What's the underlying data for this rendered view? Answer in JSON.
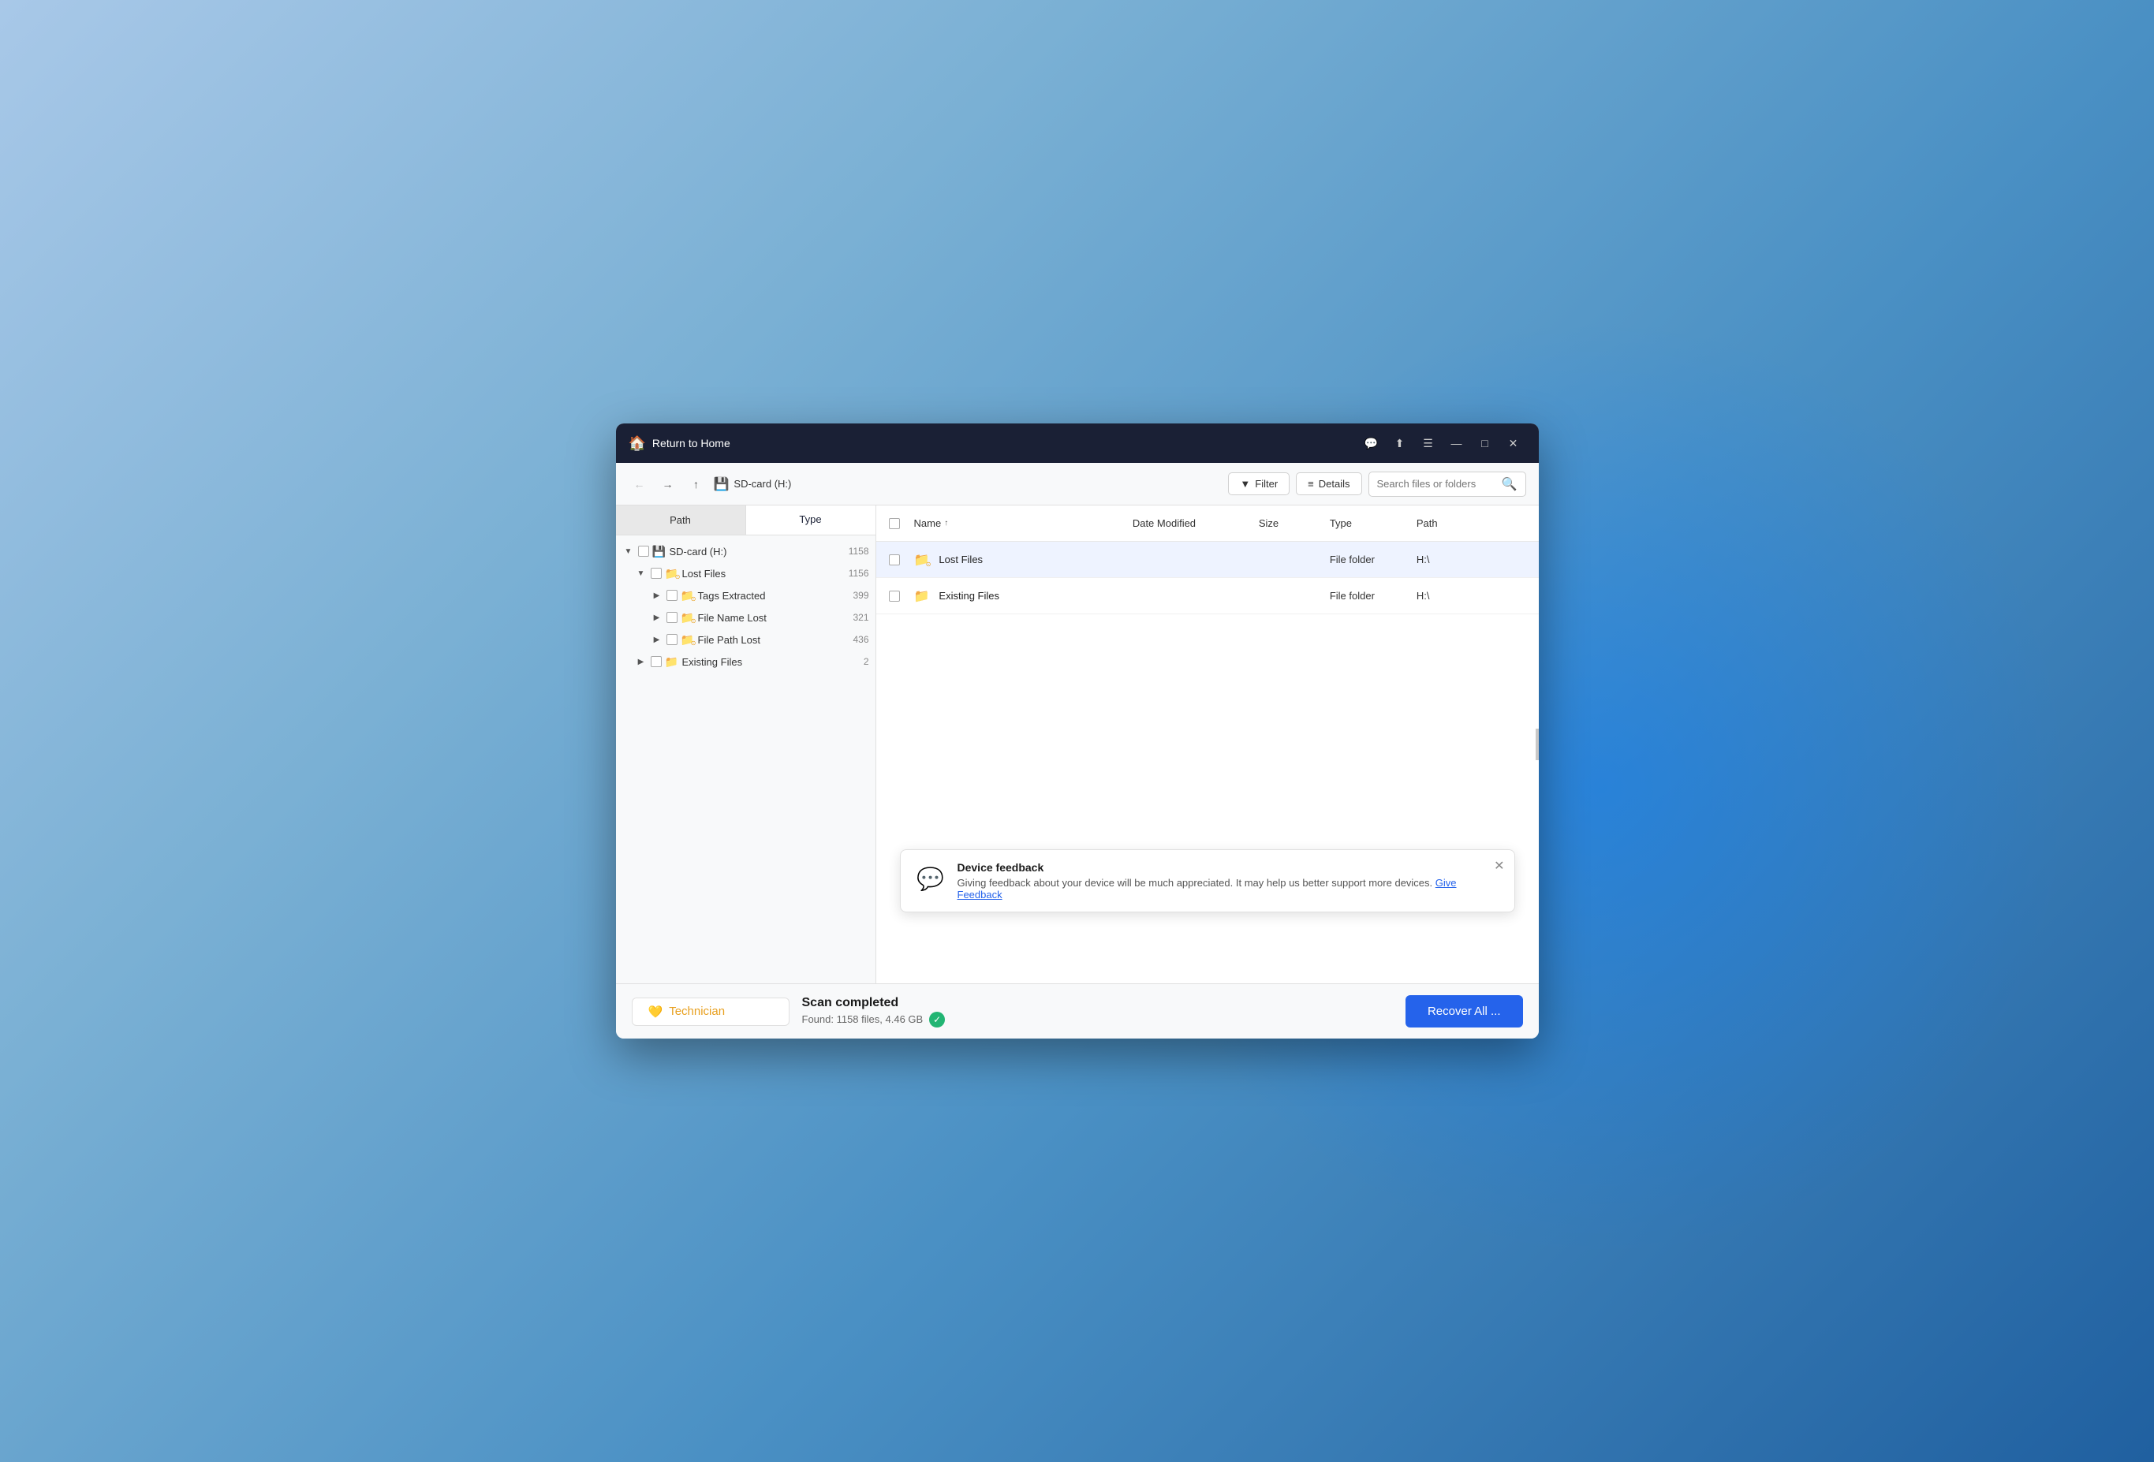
{
  "window": {
    "title": "Return to Home",
    "title_icon": "🏠"
  },
  "titlebar_controls": {
    "chat_icon": "💬",
    "upload_icon": "⬆",
    "menu_icon": "☰",
    "minimize": "—",
    "maximize": "□",
    "close": "✕"
  },
  "toolbar": {
    "back_label": "←",
    "forward_label": "→",
    "up_label": "↑",
    "drive_label": "SD-card (H:)",
    "filter_label": "Filter",
    "details_label": "Details",
    "search_placeholder": "Search files or folders"
  },
  "sidebar": {
    "tab_path": "Path",
    "tab_type": "Type",
    "tree": [
      {
        "level": 1,
        "label": "SD-card (H:)",
        "count": "1158",
        "expanded": true,
        "icon": "sd"
      },
      {
        "level": 2,
        "label": "Lost Files",
        "count": "1156",
        "expanded": true,
        "icon": "special-folder"
      },
      {
        "level": 3,
        "label": "Tags Extracted",
        "count": "399",
        "expanded": false,
        "icon": "special-folder"
      },
      {
        "level": 3,
        "label": "File Name Lost",
        "count": "321",
        "expanded": false,
        "icon": "special-folder"
      },
      {
        "level": 3,
        "label": "File Path Lost",
        "count": "436",
        "expanded": false,
        "icon": "special-folder"
      },
      {
        "level": 2,
        "label": "Existing Files",
        "count": "2",
        "expanded": false,
        "icon": "yellow-folder"
      }
    ]
  },
  "file_list": {
    "columns": {
      "name": "Name",
      "date_modified": "Date Modified",
      "size": "Size",
      "type": "Type",
      "path": "Path"
    },
    "rows": [
      {
        "name": "Lost Files",
        "date_modified": "",
        "size": "",
        "type": "File folder",
        "path": "H:\\",
        "icon": "special-folder",
        "highlighted": true
      },
      {
        "name": "Existing Files",
        "date_modified": "",
        "size": "",
        "type": "File folder",
        "path": "H:\\",
        "icon": "yellow-folder",
        "highlighted": false
      }
    ]
  },
  "feedback": {
    "title": "Device feedback",
    "message": "Giving feedback about your device will be much appreciated. It may help us better support more devices.",
    "link_text": "Give Feedback",
    "icon": "💬"
  },
  "bottom": {
    "technician_label": "Technician",
    "technician_icon": "💛",
    "scan_completed": "Scan completed",
    "scan_details": "Found: 1158 files, 4.46 GB",
    "recover_label": "Recover All ..."
  }
}
